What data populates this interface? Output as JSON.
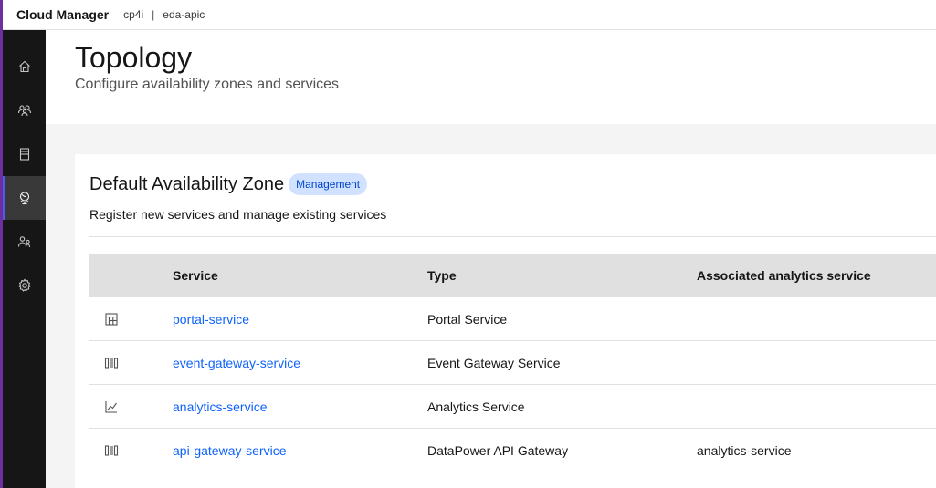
{
  "header": {
    "app_name": "Cloud Manager",
    "crumbs": [
      "cp4i",
      "eda-apic"
    ],
    "separator": "|"
  },
  "sidenav": {
    "items": [
      {
        "icon": "home-icon",
        "active": false
      },
      {
        "icon": "users-icon",
        "active": false
      },
      {
        "icon": "catalog-icon",
        "active": false
      },
      {
        "icon": "topology-globe-icon",
        "active": true
      },
      {
        "icon": "user-management-icon",
        "active": false
      },
      {
        "icon": "settings-gear-icon",
        "active": false
      }
    ],
    "active_color": "#4f5ae8"
  },
  "page": {
    "title": "Topology",
    "subtitle": "Configure availability zones and services"
  },
  "zone": {
    "title": "Default Availability Zone",
    "tag": "Management",
    "description": "Register new services and manage existing services"
  },
  "table": {
    "columns": [
      "",
      "Service",
      "Type",
      "Associated analytics service"
    ],
    "rows": [
      {
        "icon": "portal-icon",
        "service": "portal-service",
        "type": "Portal Service",
        "associated": ""
      },
      {
        "icon": "gateway-icon",
        "service": "event-gateway-service",
        "type": "Event Gateway Service",
        "associated": ""
      },
      {
        "icon": "analytics-chart-icon",
        "service": "analytics-service",
        "type": "Analytics Service",
        "associated": ""
      },
      {
        "icon": "gateway-icon",
        "service": "api-gateway-service",
        "type": "DataPower API Gateway",
        "associated": "analytics-service"
      }
    ]
  },
  "colors": {
    "link": "#0f62fe",
    "tag_bg": "#d0e2ff",
    "tag_text": "#0043ce",
    "sidenav_bg": "#161616"
  }
}
